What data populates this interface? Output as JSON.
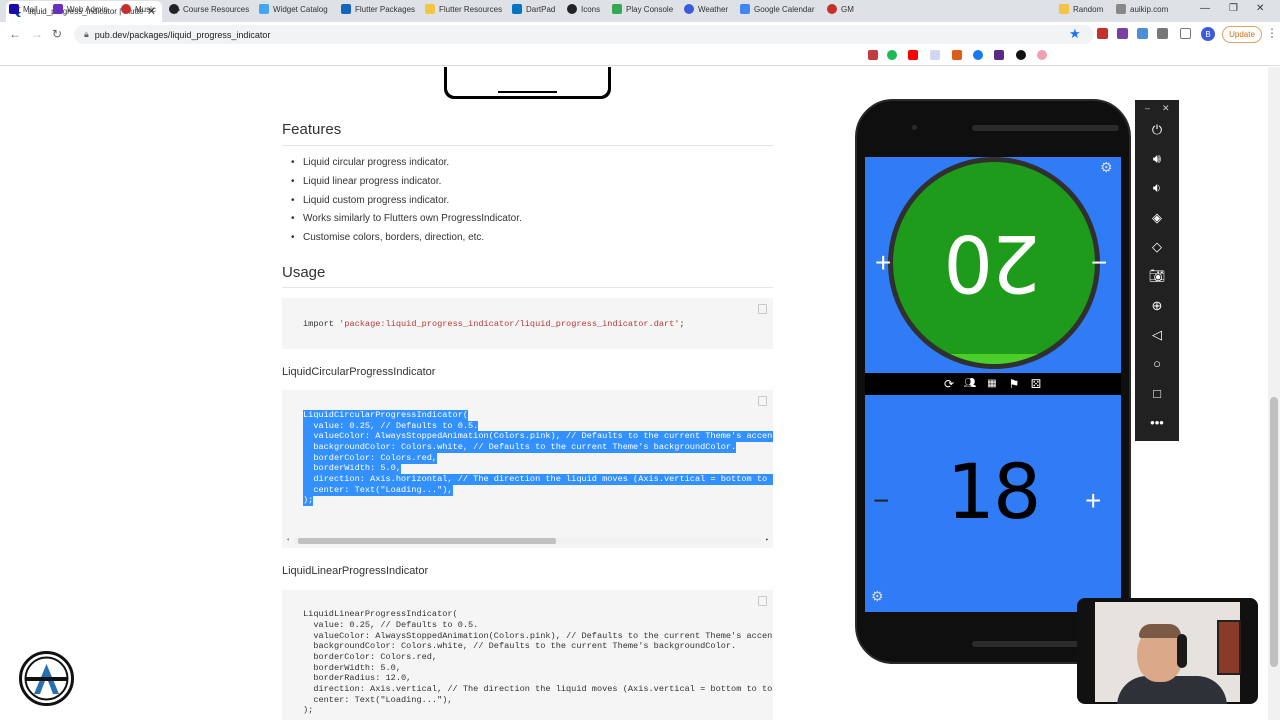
{
  "browser": {
    "tab_title": "liquid_progress_indicator | Flutte",
    "url": "pub.dev/packages/liquid_progress_indicator",
    "update_label": "Update",
    "profile_initial": "B",
    "bookmarks": [
      {
        "label": "Mail",
        "color": "#1a0dab"
      },
      {
        "label": "Web Admin",
        "color": "#6b2fbf"
      },
      {
        "label": "Music",
        "color": "#c4302b"
      },
      {
        "label": "Course Resources",
        "color": "#222222"
      },
      {
        "label": "Widget Catalog",
        "color": "#42a5f5"
      },
      {
        "label": "Flutter Packages",
        "color": "#1565c0"
      },
      {
        "label": "Flutter Resources",
        "color": "#f4c542"
      },
      {
        "label": "DartPad",
        "color": "#0175c2"
      },
      {
        "label": "Icons",
        "color": "#222222"
      },
      {
        "label": "Play Console",
        "color": "#34a853"
      },
      {
        "label": "Weather",
        "color": "#3b5bdb"
      },
      {
        "label": "Google Calendar",
        "color": "#4285f4"
      },
      {
        "label": "GM",
        "color": "#c4302b"
      },
      {
        "label": "Random",
        "color": "#f4c542"
      },
      {
        "label": "auikip.com",
        "color": "#888888"
      }
    ]
  },
  "page": {
    "features_heading": "Features",
    "features": [
      "Liquid circular progress indicator.",
      "Liquid linear progress indicator.",
      "Liquid custom progress indicator.",
      "Works similarly to Flutters own ProgressIndicator.",
      "Customise colors, borders, direction, etc."
    ],
    "usage_heading": "Usage",
    "import_keyword": "import",
    "import_string": "'package:liquid_progress_indicator/liquid_progress_indicator.dart'",
    "import_end": ";",
    "circular_heading": "LiquidCircularProgressIndicator",
    "circular_code": [
      "LiquidCircularProgressIndicator(",
      "  value: 0.25, // Defaults to 0.5.",
      "  valueColor: AlwaysStoppedAnimation(Colors.pink), // Defaults to the current Theme's accentColor.",
      "  backgroundColor: Colors.white, // Defaults to the current Theme's backgroundColor.",
      "  borderColor: Colors.red,",
      "  borderWidth: 5.0,",
      "  direction: Axis.horizontal, // The direction the liquid moves (Axis.vertical = bottom to top",
      "  center: Text(\"Loading...\"),",
      ");"
    ],
    "linear_heading": "LiquidLinearProgressIndicator",
    "linear_code": [
      "LiquidLinearProgressIndicator(",
      "  value: 0.25, // Defaults to 0.5.",
      "  valueColor: AlwaysStoppedAnimation(Colors.pink), // Defaults to the current Theme's accentColor.",
      "  backgroundColor: Colors.white, // Defaults to the current Theme's backgroundColor.",
      "  borderColor: Colors.red,",
      "  borderWidth: 5.0,",
      "  borderRadius: 12.0,",
      "  direction: Axis.vertical, // The direction the liquid moves (Axis.vertical = bottom to top",
      "  center: Text(\"Loading...\"),",
      ");"
    ]
  },
  "app": {
    "player_top_score": "20",
    "player_bottom_score": "18",
    "plus": "+",
    "minus": "−",
    "colors": {
      "background": "#2f7cf6",
      "circle": "#1e9b1b",
      "liquid": "#4cce2a",
      "ring": "#303030"
    },
    "toolbar_icons": [
      "refresh-icon",
      "people-icon",
      "table-icon",
      "flag-icon",
      "dice-icon"
    ]
  },
  "emulator": {
    "controls": [
      "power-icon",
      "volume-up-icon",
      "volume-down-icon",
      "rotate-left-icon",
      "rotate-right-icon",
      "camera-icon",
      "zoom-icon",
      "back-icon",
      "home-icon",
      "overview-icon",
      "more-icon"
    ]
  }
}
